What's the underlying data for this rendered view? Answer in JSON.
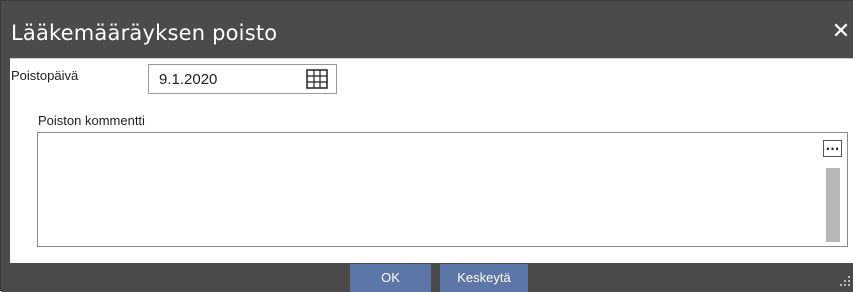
{
  "dialog": {
    "title": "Lääkemääräyksen poisto",
    "close_icon": "close-icon"
  },
  "form": {
    "date_label": "Poistopäivä",
    "date_value": "9.1.2020",
    "calendar_icon": "calendar-icon",
    "comment_label": "Poiston kommentti",
    "comment_value": "",
    "more_label": "..."
  },
  "footer": {
    "ok_label": "OK",
    "cancel_label": "Keskeytä"
  },
  "colors": {
    "titlebar": "#4b4b4b",
    "button": "#5c76a8",
    "scrollbar": "#b8b8b8"
  }
}
